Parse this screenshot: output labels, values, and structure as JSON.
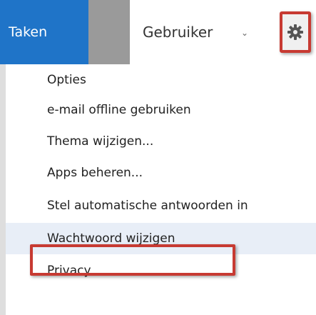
{
  "header": {
    "tab_label": "Taken",
    "user_name": "Gebruiker",
    "caret_glyph": "⌄",
    "gear_icon": "gear-icon",
    "accent_color": "#1f74c8",
    "highlight_color": "#c73a32"
  },
  "menu": {
    "items": [
      {
        "label": "Opties"
      },
      {
        "label": "e-mail offline gebruiken"
      },
      {
        "label": "Thema wijzigen..."
      },
      {
        "label": "Apps beheren..."
      },
      {
        "label": "Stel automatische antwoorden in"
      },
      {
        "label": "Wachtwoord wijzigen",
        "highlighted": true
      },
      {
        "label": "Privacy"
      }
    ]
  }
}
